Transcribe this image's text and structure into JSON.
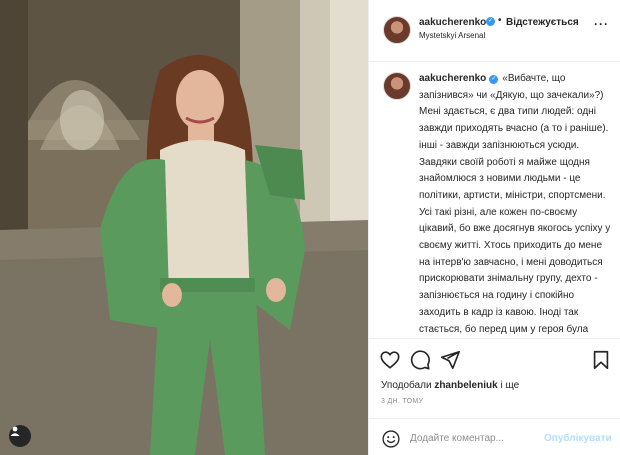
{
  "post": {
    "image_alt": "Фото",
    "author": {
      "username": "aakucherenko",
      "verified": true,
      "follow_state": "Відстежується",
      "location": "Mystetskyi Arsenal"
    },
    "caption": {
      "username": "aakucherenko",
      "text": "«Вибачте, що запізнився» чи «Дякую, що зачекали»?) Мені здається, є два типи людей: одні завжди приходять вчасно (а то і раніше). інші - завжди запізнюються усюди. Завдяки своїй роботі я майже щодня знайомлюся з новими людьми - це політики, артисти, міністри, спортсмени. Усі такі різні, але кожен по-своєму цікавий, бо вже досягнув якогось успіху у своєму житті. Хтось приходить до мене на інтерв'ю завчасно, і мені доводиться прискорювати знімальну групу, дехто - запізнюється на годину і спокійно заходить в кадр із кавою. Іноді так стається, бо перед цим у героя була «розмова з Президентом» або нестача - пірка"
    },
    "likes": {
      "prefix": "Уподобали",
      "user": "zhanbeleniuk",
      "suffix": " і ще"
    },
    "timestamp": "3 ДН. ТОМУ",
    "comment": {
      "placeholder": "Додайте коментар...",
      "post_label": "Опублікувати"
    },
    "icons": {
      "like": "heart-icon",
      "comment": "comment-icon",
      "share": "paper-plane-icon",
      "save": "bookmark-icon",
      "emoji": "smiley-icon",
      "more": "more-options-icon",
      "tags": "user-tag-icon"
    },
    "colors": {
      "verified": "#3897f0",
      "post_disabled": "#b2dffc",
      "meta_gray": "#8e8e8e",
      "jacket_green": "#5a9a5c"
    }
  }
}
